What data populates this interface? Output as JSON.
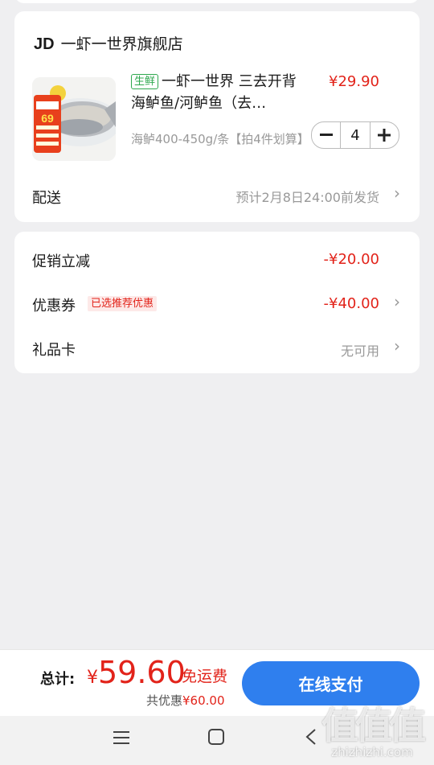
{
  "store": {
    "brand": "JD",
    "name": "一虾一世界旗舰店"
  },
  "product": {
    "tag": "生鲜",
    "title": "一虾一世界 三去开背海鲈鱼/河鲈鱼（去…",
    "price": "¥29.90",
    "spec": "海鲈400-450g/条【拍4件划算】",
    "quantity": "4",
    "image_badge_text": "69"
  },
  "delivery": {
    "label": "配送",
    "value": "预计2月8日24:00前发货"
  },
  "promotions": {
    "promo_label": "促销立减",
    "promo_value": "-¥20.00",
    "coupon_label": "优惠券",
    "coupon_tag": "已选推荐优惠",
    "coupon_value": "-¥40.00",
    "giftcard_label": "礼品卡",
    "giftcard_value": "无可用"
  },
  "checkout": {
    "total_label": "总计:",
    "currency": "¥",
    "total_amount": "59.60",
    "free_shipping": "免运费",
    "discount_label": "共优惠",
    "discount_amount": "¥60.00",
    "pay_button": "在线支付"
  },
  "watermark": {
    "main": "值值值",
    "sub": "zhizhizhi.com"
  },
  "colors": {
    "accent_red": "#e2231a",
    "pay_blue": "#2f7fee",
    "fresh_green": "#2fa84f"
  },
  "icons": {
    "minus": "minus-icon",
    "plus": "plus-icon",
    "chevron": "chevron-right-icon",
    "nav_menu": "menu-icon",
    "nav_home": "home-square-icon",
    "nav_back": "back-icon"
  }
}
